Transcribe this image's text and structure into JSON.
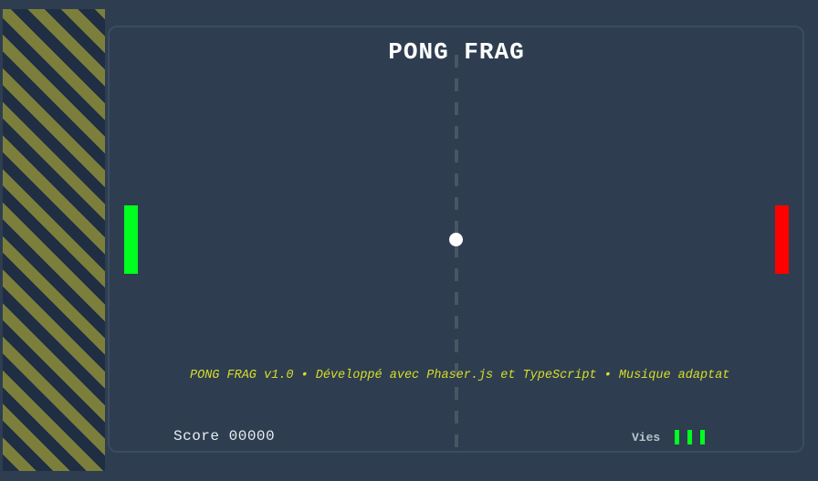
{
  "game": {
    "title": "PONG FRAG",
    "ticker": "PONG FRAG v1.0 • Développé avec Phaser.js et TypeScript • Musique adaptat",
    "score_label": "Score 00000",
    "lives_label": "Vies",
    "lives_count": 3
  },
  "colors": {
    "background": "#2e3e50",
    "player_paddle": "#00ff1e",
    "opponent_paddle": "#ff0000",
    "ball": "#ffffff",
    "ticker_text": "#d8dd2a",
    "hazard_stripe_dark": "#1f2e42",
    "hazard_stripe_light": "#7c7f3c"
  }
}
